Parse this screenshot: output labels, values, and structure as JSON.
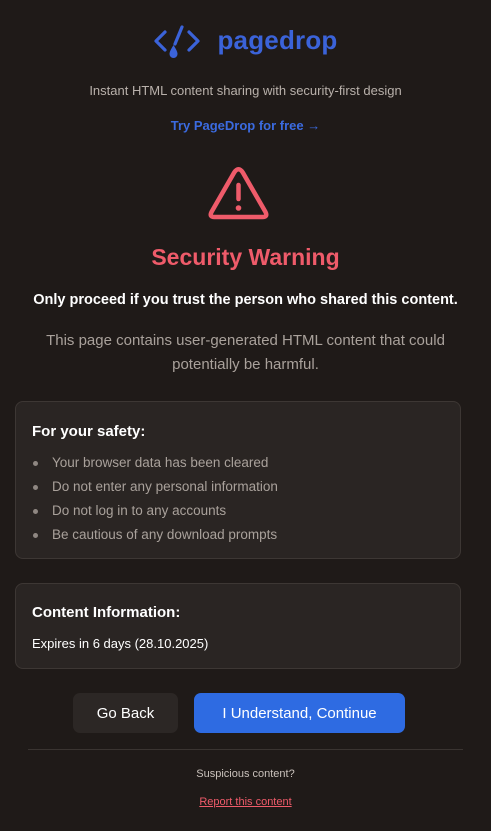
{
  "brand": {
    "name": "pagedrop",
    "tagline": "Instant HTML content sharing with security-first design",
    "cta_link": "Try PageDrop for free →",
    "brand_color": "#3b63d9"
  },
  "warning": {
    "icon": "warning-triangle-icon",
    "title": "Security Warning",
    "trust_line": "Only proceed if you trust the person who shared this content.",
    "description": "This page contains user-generated HTML content that could potentially be harmful.",
    "accent_color": "#ef5b6a"
  },
  "safety": {
    "title": "For your safety:",
    "items": [
      "Your browser data has been cleared",
      "Do not enter any personal information",
      "Do not log in to any accounts",
      "Be cautious of any download prompts"
    ]
  },
  "content_info": {
    "title": "Content Information:",
    "expiry": "Expires in 6 days (28.10.2025)"
  },
  "actions": {
    "back_label": "Go Back",
    "continue_label": "I Understand, Continue",
    "continue_color": "#2e6be2"
  },
  "footer": {
    "suspicious": "Suspicious content?",
    "report": "Report this content"
  }
}
